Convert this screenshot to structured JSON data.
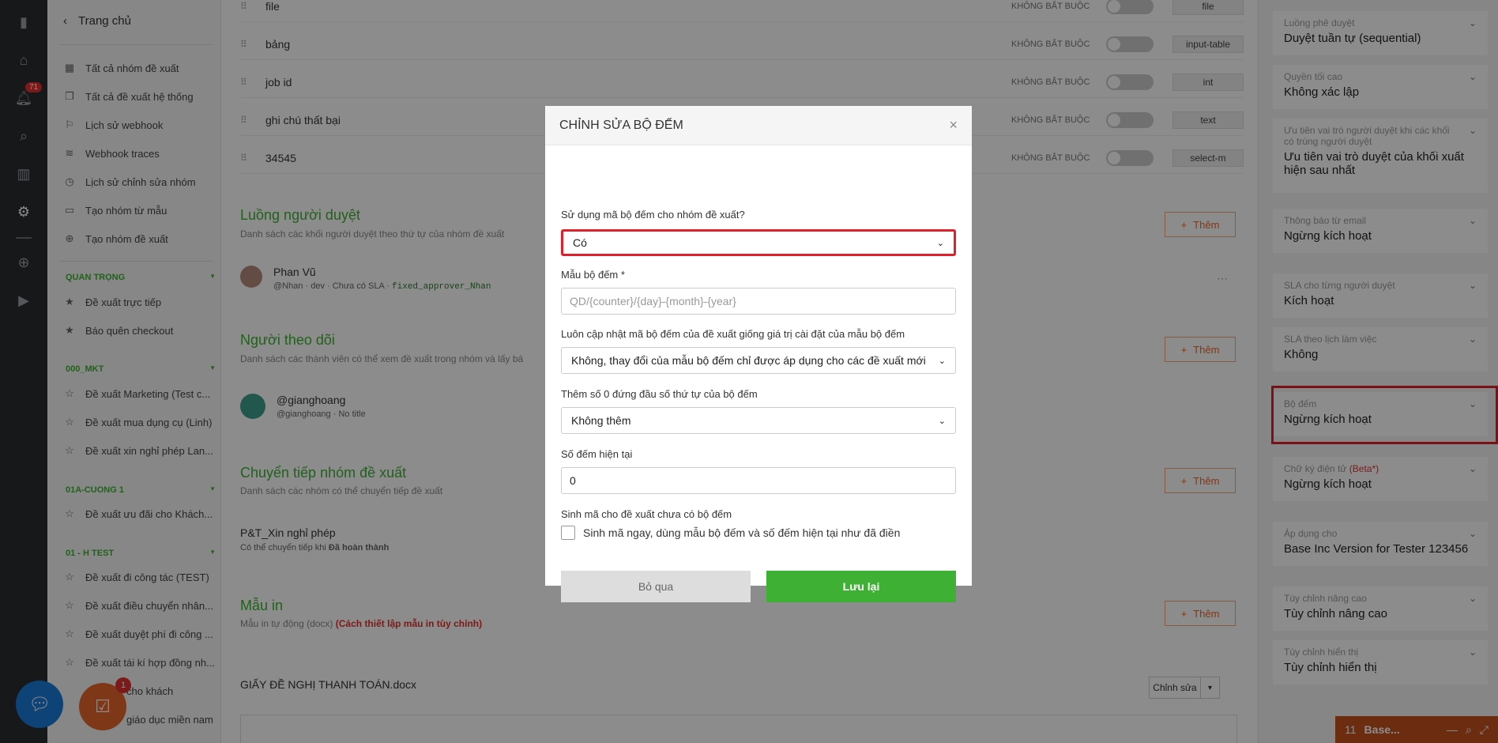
{
  "rail": {
    "notification_count": "71"
  },
  "nav": {
    "back_label": "Trang chủ",
    "top_items": [
      {
        "label": "Tất cả nhóm đề xuất"
      },
      {
        "label": "Tất cả đề xuất hệ thống"
      },
      {
        "label": "Lịch sử webhook"
      },
      {
        "label": "Webhook traces"
      },
      {
        "label": "Lịch sử chỉnh sửa nhóm"
      },
      {
        "label": "Tạo nhóm từ mẫu"
      },
      {
        "label": "Tạo nhóm đề xuất"
      }
    ],
    "sections": [
      {
        "title": "QUAN TRỌNG",
        "items": [
          "Đề xuất trực tiếp",
          "Báo quên checkout"
        ]
      },
      {
        "title": "000_MKT",
        "items": [
          "Đề xuất Marketing (Test c...",
          "Đề xuất mua dụng cụ (Linh)",
          "Đề xuất xin nghỉ phép Lan..."
        ]
      },
      {
        "title": "01A-CUONG 1",
        "items": [
          "Đề xuất ưu đãi cho Khách..."
        ]
      },
      {
        "title": "01 - H TEST",
        "items": [
          "Đề xuất đi công tác (TEST)",
          "Đề xuất điều chuyển nhân...",
          "Đề xuất duyệt phí đi công ...",
          "Đề xuất tái kí hợp đồng nh...",
          "cho khách",
          "giáo dục miền nam"
        ]
      }
    ]
  },
  "fields": [
    {
      "name": "file",
      "req": "KHÔNG BẮT BUỘC",
      "type": "file"
    },
    {
      "name": "bảng",
      "req": "KHÔNG BẮT BUỘC",
      "type": "input-table"
    },
    {
      "name": "job id",
      "req": "KHÔNG BẮT BUỘC",
      "type": "int"
    },
    {
      "name": "ghi chú thất bại",
      "req": "KHÔNG BẮT BUỘC",
      "type": "text"
    },
    {
      "name": "34545",
      "req": "KHÔNG BẮT BUỘC",
      "type": "select-m"
    }
  ],
  "approvers": {
    "title": "Luồng người duyệt",
    "subtitle": "Danh sách các khối người duyệt theo thứ tự của nhóm đề xuất",
    "add_label": "Thêm",
    "person_name": "Phan Vũ",
    "person_handle": "@Nhan",
    "person_meta": "· dev · Chưa có SLA ·",
    "person_code": "fixed_approver_Nhan"
  },
  "followers": {
    "title": "Người theo dõi",
    "subtitle": "Danh sách các thành viên có thể xem đề xuất trong nhóm và lấy bá",
    "add_label": "Thêm",
    "person_name": "@gianghoang",
    "person_handle": "@gianghoang",
    "person_meta": "· No title"
  },
  "forward": {
    "title": "Chuyển tiếp nhóm đề xuất",
    "subtitle": "Danh sách các nhóm có thể chuyển tiếp đề xuất",
    "add_label": "Thêm",
    "group_name": "P&T_Xin nghỉ phép",
    "group_meta": "Có thể chuyển tiếp khi",
    "group_meta_bold": "Đã hoàn thành"
  },
  "print": {
    "title": "Mẫu in",
    "subtitle": "Mẫu in tự động (docx)",
    "link": "(Cách thiết lập mẫu in tùy chỉnh)",
    "add_label": "Thêm",
    "doc_name": "GIẤY ĐỀ NGHỊ THANH TOÁN.docx",
    "edit_label": "Chỉnh sửa"
  },
  "right_panel": [
    {
      "label": "Luồng phê duyệt",
      "value": "Duyệt tuần tự (sequential)"
    },
    {
      "label": "Quyền tối cao",
      "value": "Không xác lập"
    },
    {
      "label": "Ưu tiên vai trò người duyệt khi các khối có trùng người duyệt",
      "value": "Ưu tiên vai trò duyệt của khối xuất hiện sau nhất"
    },
    {
      "label": "Thông báo từ email",
      "value": "Ngừng kích hoạt"
    },
    {
      "label": "SLA cho từng người duyệt",
      "value": "Kích hoạt"
    },
    {
      "label": "SLA theo lịch làm việc",
      "value": "Không"
    },
    {
      "label": "Bộ đếm",
      "value": "Ngừng kích hoạt"
    },
    {
      "label": "Chữ ký điện tử",
      "label_extra": "(Beta*)",
      "value": "Ngừng kích hoạt"
    },
    {
      "label": "Áp dụng cho",
      "value": "Base Inc Version for Tester 123456"
    },
    {
      "label": "Tùy chỉnh nâng cao",
      "value": "Tùy chỉnh nâng cao"
    },
    {
      "label": "Tùy chỉnh hiển thị",
      "value": "Tùy chỉnh hiển thị"
    }
  ],
  "widgets": {
    "task_count": "1",
    "base_count": "11",
    "base_label": "Base..."
  },
  "modal": {
    "title": "CHỈNH SỬA BỘ ĐẾM",
    "q1_label": "Sử dụng mã bộ đếm cho nhóm đề xuất?",
    "q1_value": "Có",
    "q2_label": "Mẫu bộ đếm *",
    "q2_placeholder": "QD/{counter}/{day}-{month}-{year}",
    "q3_label": "Luôn cập nhật mã bộ đếm của đề xuất giống giá trị cài đặt của mẫu bộ đếm",
    "q3_value": "Không, thay đổi của mẫu bộ đếm chỉ được áp dụng cho các đề xuất mới",
    "q4_label": "Thêm số 0 đứng đầu số thứ tự của bộ đếm",
    "q4_value": "Không thêm",
    "q5_label": "Số đếm hiện tại",
    "q5_value": "0",
    "q6_label": "Sinh mã cho đề xuất chưa có bộ đếm",
    "q6_checkbox": "Sinh mã ngay, dùng mẫu bộ đếm và số đếm hiện tại như đã điền",
    "cancel_label": "Bỏ qua",
    "save_label": "Lưu lại"
  }
}
